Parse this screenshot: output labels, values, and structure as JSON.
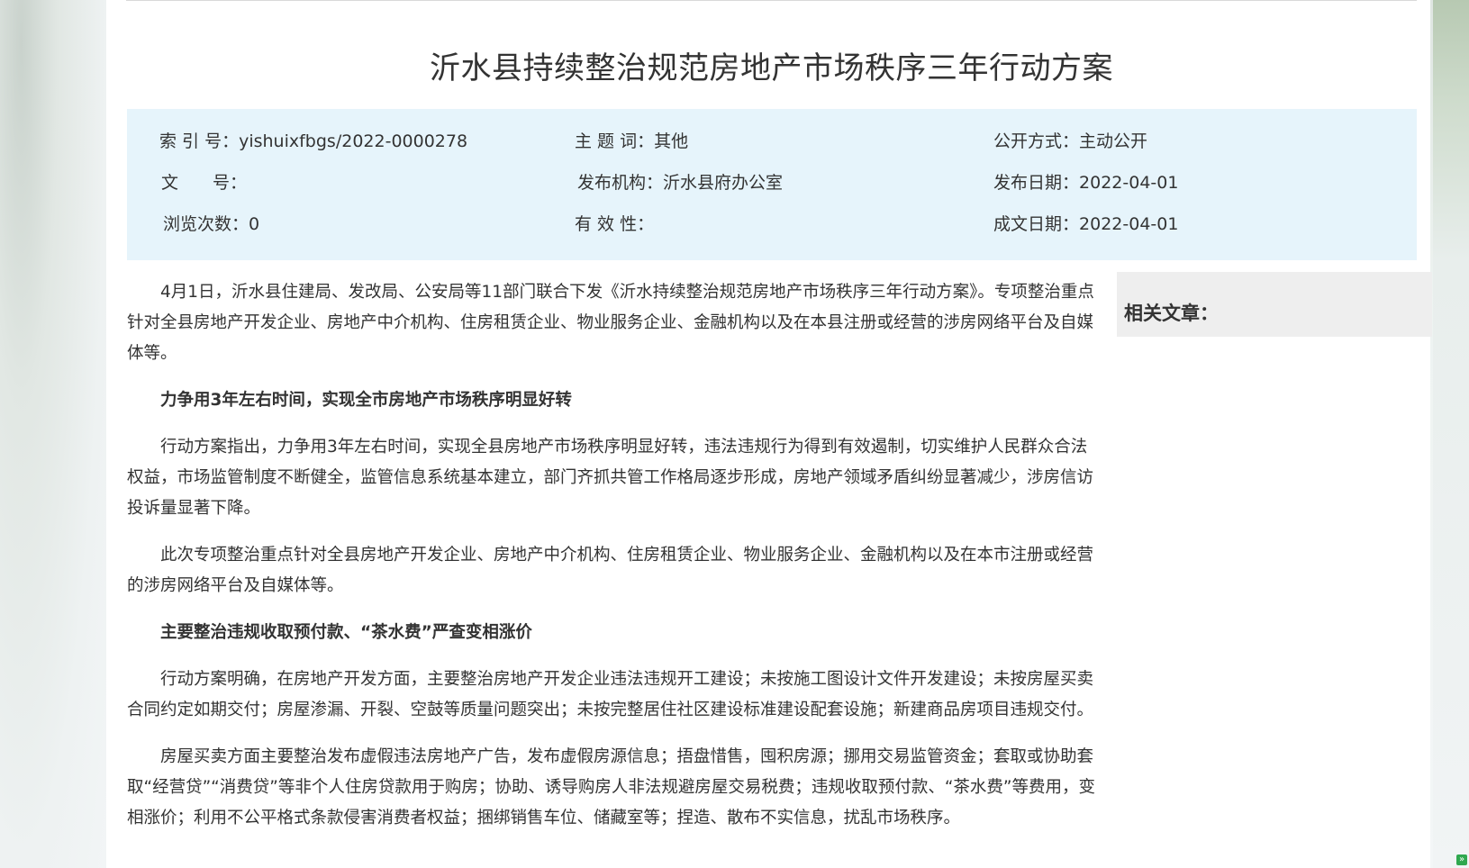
{
  "article": {
    "title": "沂水县持续整治规范房地产市场秩序三年行动方案"
  },
  "meta": {
    "index_label": "索 引 号：",
    "index_value": "yishuixfbgs/2022-0000278",
    "subject_label": "主 题 词：",
    "subject_value": "其他",
    "disclosure_label": "公开方式：",
    "disclosure_value": "主动公开",
    "docno_label": "文　　号：",
    "docno_value": "",
    "publisher_label": "发布机构：",
    "publisher_value": "沂水县府办公室",
    "publish_date_label": "发布日期：",
    "publish_date_value": "2022-04-01",
    "views_label": "浏览次数：",
    "views_value": "0",
    "validity_label": "有 效 性：",
    "validity_value": "",
    "written_date_label": "成文日期：",
    "written_date_value": "2022-04-01"
  },
  "body": {
    "p1": "4月1日，沂水县住建局、发改局、公安局等11部门联合下发《沂水持续整治规范房地产市场秩序三年行动方案》。专项整治重点针对全县房地产开发企业、房地产中介机构、住房租赁企业、物业服务企业、金融机构以及在本县注册或经营的涉房网络平台及自媒体等。",
    "h1": "力争用3年左右时间，实现全市房地产市场秩序明显好转",
    "p2": "行动方案指出，力争用3年左右时间，实现全县房地产市场秩序明显好转，违法违规行为得到有效遏制，切实维护人民群众合法权益，市场监管制度不断健全，监管信息系统基本建立，部门齐抓共管工作格局逐步形成，房地产领域矛盾纠纷显著减少，涉房信访投诉量显著下降。",
    "p3": "此次专项整治重点针对全县房地产开发企业、房地产中介机构、住房租赁企业、物业服务企业、金融机构以及在本市注册或经营的涉房网络平台及自媒体等。",
    "h2": "主要整治违规收取预付款、“茶水费”严查变相涨价",
    "p4": "行动方案明确，在房地产开发方面，主要整治房地产开发企业违法违规开工建设；未按施工图设计文件开发建设；未按房屋买卖合同约定如期交付；房屋渗漏、开裂、空鼓等质量问题突出；未按完整居住社区建设标准建设配套设施；新建商品房项目违规交付。",
    "p5": "房屋买卖方面主要整治发布虚假违法房地产广告，发布虚假房源信息；捂盘惜售，囤积房源；挪用交易监管资金；套取或协助套取“经营贷”“消费贷”等非个人住房贷款用于购房；协助、诱导购房人非法规避房屋交易税费；违规收取预付款、“茶水费”等费用，变相涨价；利用不公平格式条款侵害消费者权益；捆绑销售车位、储藏室等；捏造、散布不实信息，扰乱市场秩序。"
  },
  "sidebar": {
    "related_title": "相关文章："
  }
}
